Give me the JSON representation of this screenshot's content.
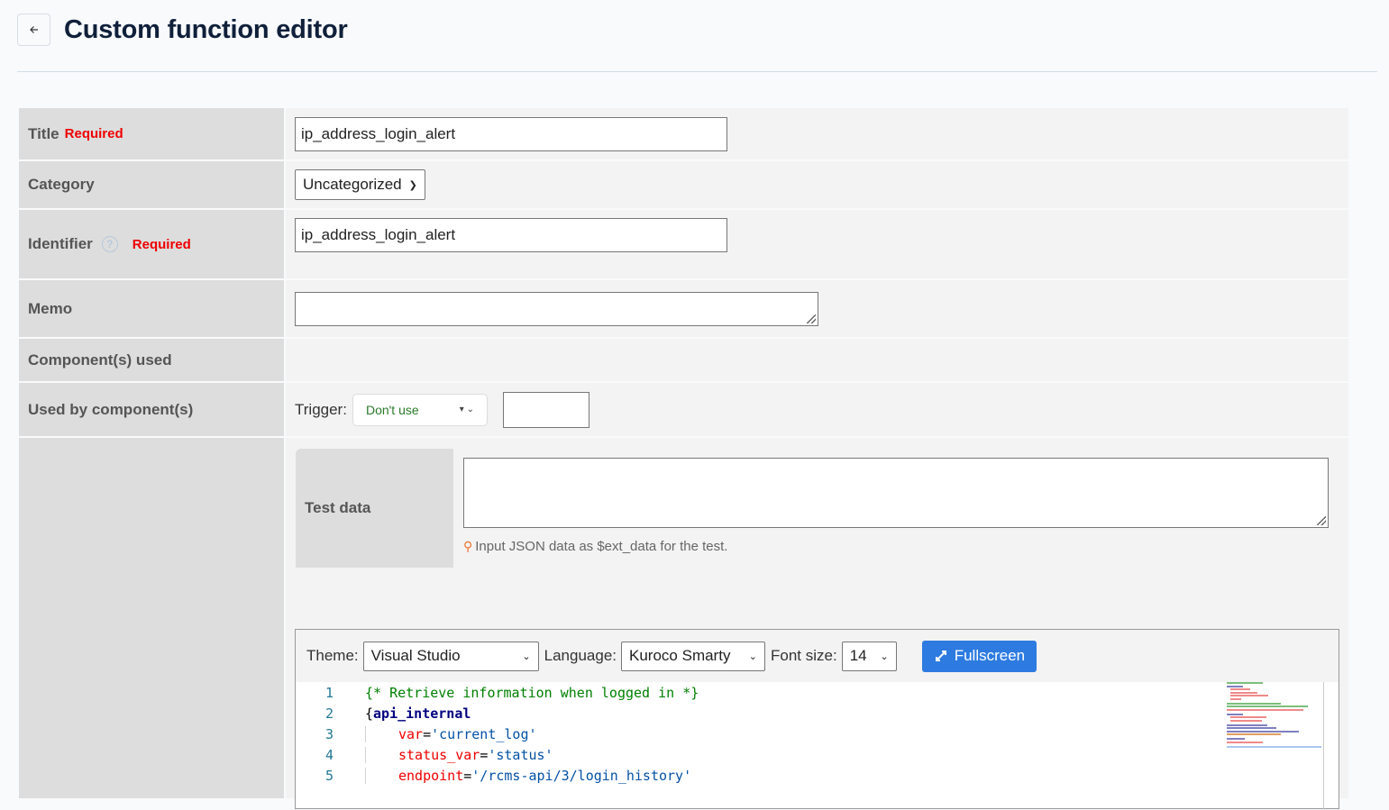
{
  "header": {
    "back_icon": "arrow-left-icon",
    "title": "Custom function editor"
  },
  "form": {
    "title": {
      "label": "Title",
      "required": "Required",
      "value": "ip_address_login_alert"
    },
    "category": {
      "label": "Category",
      "value": "Uncategorized"
    },
    "identifier": {
      "label": "Identifier",
      "help_icon": "question-circle-icon",
      "required": "Required",
      "value": "ip_address_login_alert"
    },
    "memo": {
      "label": "Memo",
      "value": ""
    },
    "components_used": {
      "label": "Component(s) used"
    },
    "used_by": {
      "label": "Used by component(s)",
      "trigger_label": "Trigger:",
      "trigger_value": "Don't use",
      "extra_value": ""
    },
    "test_data": {
      "label": "Test data",
      "value": "",
      "hint_icon": "lightbulb-icon",
      "hint": "Input JSON data as $ext_data for the test."
    }
  },
  "editor": {
    "theme_label": "Theme:",
    "theme_value": "Visual Studio",
    "language_label": "Language:",
    "language_value": "Kuroco Smarty",
    "font_size_label": "Font size:",
    "font_size_value": "14",
    "fullscreen_icon": "expand-arrows-icon",
    "fullscreen_label": "Fullscreen",
    "lines": [
      {
        "n": "1",
        "text": "{* Retrieve information when logged in *}"
      },
      {
        "n": "2",
        "brace": "{",
        "tag": "api_internal"
      },
      {
        "n": "3",
        "attr": "var",
        "eq": "=",
        "str": "'current_log'"
      },
      {
        "n": "4",
        "attr": "status_var",
        "eq": "=",
        "str": "'status'"
      },
      {
        "n": "5",
        "attr": "endpoint",
        "eq": "=",
        "str": "'/rcms-api/3/login_history'"
      }
    ]
  }
}
